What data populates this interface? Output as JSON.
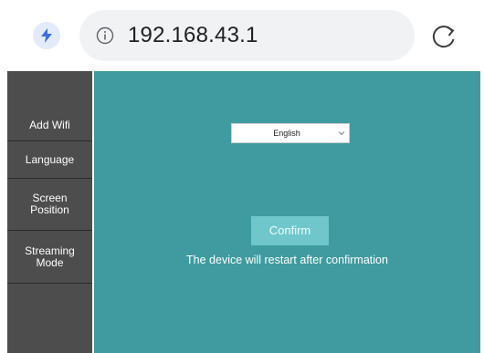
{
  "browser": {
    "url": "192.168.43.1",
    "leading_icon": "lightning-bolt-icon",
    "info_icon": "info-icon",
    "reload_icon": "reload-icon",
    "accent_color": "#3b6fe0"
  },
  "sidebar": {
    "background": "#4d4d4d",
    "items": [
      {
        "label": "Add Wifi"
      },
      {
        "label": "Language"
      },
      {
        "label": "Screen\nPosition"
      },
      {
        "label": "Streaming\nMode"
      }
    ]
  },
  "main": {
    "background": "#3f9ba0",
    "language_select": {
      "selected": "English",
      "icon": "chevron-down-icon"
    },
    "confirm_label": "Confirm",
    "confirm_color": "#6fc7cc",
    "notice": "The device will restart after confirmation"
  }
}
